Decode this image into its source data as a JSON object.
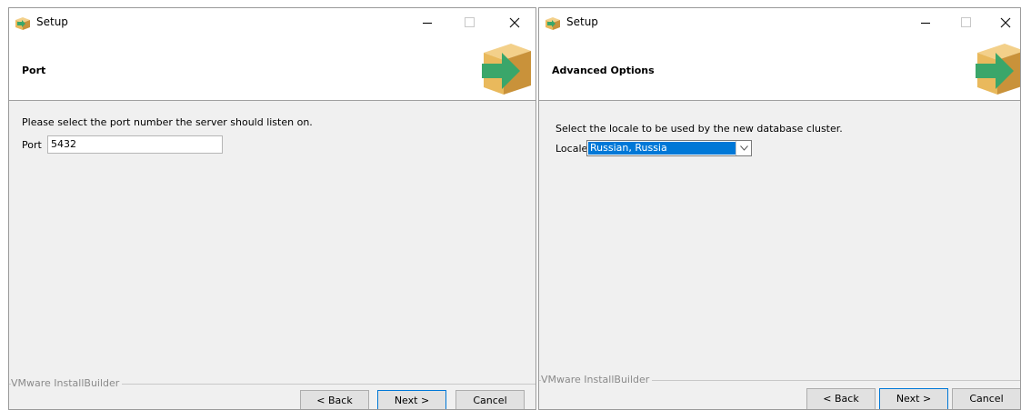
{
  "windows": [
    {
      "title": "Setup",
      "header_title": "Port",
      "instruction": "Please select the port number the server should listen on.",
      "field_label": "Port",
      "field_value": "5432",
      "footer_brand": "VMware InstallBuilder",
      "buttons": {
        "back": "< Back",
        "next": "Next >",
        "cancel": "Cancel"
      }
    },
    {
      "title": "Setup",
      "header_title": "Advanced Options",
      "instruction": "Select the locale to be used by the new database cluster.",
      "field_label": "Locale",
      "field_value": "Russian, Russia",
      "footer_brand": "VMware InstallBuilder",
      "buttons": {
        "back": "< Back",
        "next": "Next >",
        "cancel": "Cancel"
      }
    }
  ],
  "icons": {
    "app": "installer-box-icon",
    "logo": "installer-box-arrow-icon",
    "minimize": "minimize-icon",
    "maximize": "maximize-icon",
    "close": "close-icon",
    "dropdown": "chevron-down-icon"
  },
  "colors": {
    "box_tan": "#e9b95c",
    "box_shadow": "#c9923a",
    "arrow_green": "#3aa66a",
    "selection_blue": "#0078d7",
    "window_bg": "#f0f0f0"
  }
}
